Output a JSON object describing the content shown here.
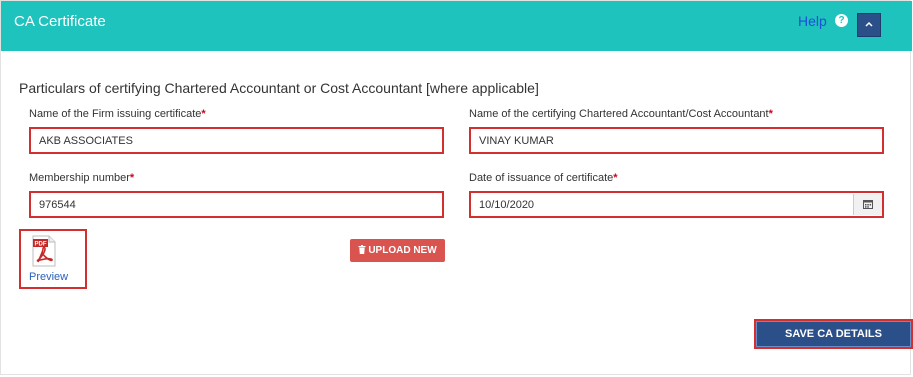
{
  "header": {
    "title": "CA Certificate",
    "help_label": "Help",
    "help_icon": "question-circle-icon",
    "collapse_icon": "chevron-up-icon"
  },
  "section_title": "Particulars of certifying Chartered Accountant or Cost Accountant [where applicable]",
  "fields": {
    "firm_name": {
      "label": "Name of the Firm issuing certificate",
      "value": "AKB ASSOCIATES",
      "required": "*"
    },
    "ca_name": {
      "label": "Name of the certifying Chartered Accountant/Cost Accountant",
      "value": "VINAY KUMAR",
      "required": "*"
    },
    "membership_number": {
      "label": "Membership number",
      "value": "976544",
      "required": "*"
    },
    "date_of_issuance": {
      "label": "Date of issuance of certificate",
      "value": "10/10/2020",
      "required": "*"
    }
  },
  "attachment": {
    "icon": "pdf-icon",
    "badge": "PDF",
    "preview_label": "Preview"
  },
  "buttons": {
    "upload_label": "UPLOAD NEW",
    "upload_icon": "trash-icon",
    "save_label": "SAVE CA DETAILS"
  },
  "colors": {
    "header_bg": "#1ec3bd",
    "primary_btn": "#2b4f88",
    "danger_btn": "#d9534f",
    "highlight_border": "#d32f2f"
  }
}
